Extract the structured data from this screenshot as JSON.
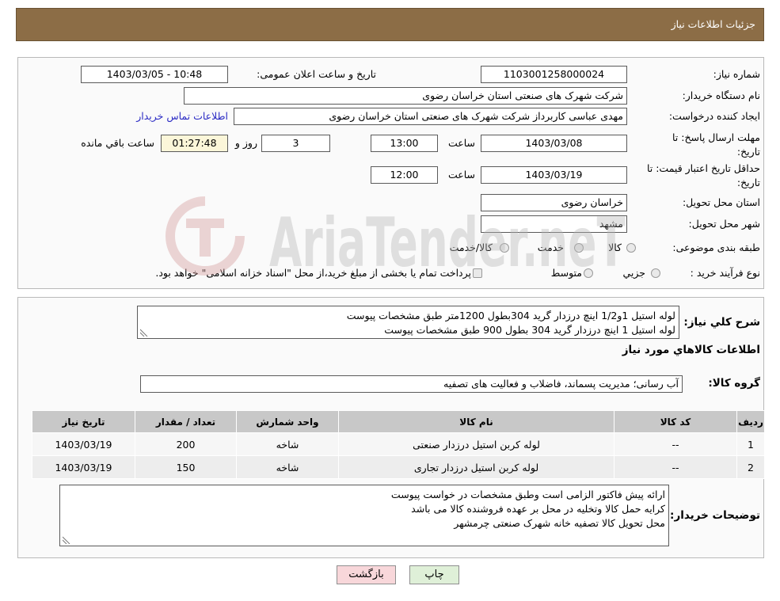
{
  "header": {
    "title": "جزئیات اطلاعات نیاز"
  },
  "watermark": {
    "text": "AriaTender.neT"
  },
  "colors": {
    "header_bg": "#8c6d46",
    "link": "#2b2bc4",
    "table_header_bg": "#c8c8c8",
    "print_button_bg": "#dff0d8",
    "back_button_bg": "#f8d7da"
  },
  "icons": {
    "textarea_resize": "resize-grip-icon",
    "watermark_logo": "watermark-logo-icon"
  },
  "need_info": {
    "need_number_label": "شماره نیاز:",
    "need_number": "1103001258000024",
    "announce_label": "تاریخ و ساعت اعلان عمومی:",
    "announce_datetime": "1403/03/05 - 10:48",
    "buyer_org_label": "نام دستگاه خریدار:",
    "buyer_org": "شرکت شهرک های صنعتی استان خراسان رضوی",
    "requester_label": "ایجاد کننده درخواست:",
    "requester": "مهدی عباسی کاربرداز شرکت شهرک های صنعتی استان خراسان رضوی",
    "contact_link": "اطلاعات تماس خریدار",
    "deadline": {
      "label_line1": "مهلت ارسال پاسخ: تا",
      "label_line2": "تاریخ:",
      "date": "1403/03/08",
      "time_label": "ساعت",
      "time": "13:00",
      "days": "3",
      "days_label": "روز و",
      "remaining": "01:27:48",
      "remaining_label": "ساعت باقي مانده"
    },
    "price_validity": {
      "label_line1": "حداقل تاریخ اعتبار قیمت: تا",
      "label_line2": "تاریخ:",
      "date": "1403/03/19",
      "time_label": "ساعت",
      "time": "12:00"
    },
    "province_label": "استان محل تحویل:",
    "province": "خراسان رضوی",
    "city_label": "شهر محل تحویل:",
    "city": "مشهد",
    "category": {
      "label": "طبقه بندی موضوعی:",
      "options": [
        "کالا",
        "خدمت",
        "کالا/خدمت"
      ]
    },
    "process": {
      "label": "نوع فرآیند خرید :",
      "options": [
        "جزيي",
        "متوسط"
      ],
      "treasury_note": "پرداخت تمام یا بخشی از مبلغ خرید،از محل \"اسناد خزانه اسلامی\" خواهد بود."
    }
  },
  "description": {
    "label": "شرح کلي نياز:",
    "lines": [
      "لوله استیل 1و1/2 اینچ درزدار گرید 304بطول 1200متر طبق مشخصات پیوست",
      "لوله استیل 1 اینچ درزدار گرید 304 بطول 900 طبق مشخصات پیوست"
    ]
  },
  "items": {
    "heading": "اطلاعات کالاهاي مورد نياز",
    "group_label": "گروه کالا:",
    "group": "آب رسانی؛ مدیریت پسماند، فاضلاب و فعالیت های تصفیه",
    "columns": [
      "ردیف",
      "کد کالا",
      "نام کالا",
      "واحد شمارش",
      "تعداد / مقدار",
      "تاریخ نیاز"
    ],
    "rows": [
      [
        "1",
        "--",
        "لوله کربن استیل درزدار صنعتی",
        "شاخه",
        "200",
        "1403/03/19"
      ],
      [
        "2",
        "--",
        "لوله کربن استیل درزدار تجاری",
        "شاخه",
        "150",
        "1403/03/19"
      ]
    ]
  },
  "buyer_notes": {
    "label": "توضیحات خریدار:",
    "lines": [
      "ارائه پیش فاکتور الزامی است وطبق مشخصات در خواست پیوست",
      "کرایه حمل کالا وتخلیه در محل بر عهده فروشنده کالا می باشد",
      "محل تحویل کالا تصفیه خانه شهرک صنعتی چرمشهر"
    ]
  },
  "actions": {
    "print": "چاپ",
    "back": "بازگشت"
  }
}
